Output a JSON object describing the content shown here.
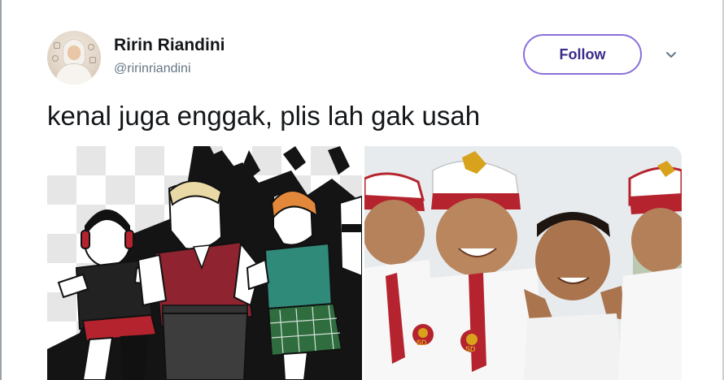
{
  "tweet": {
    "author_name": "Ririn Riandini",
    "author_handle": "@ririnriandini",
    "follow_label": "Follow",
    "text": "kenal juga enggak, plis lah gak usah"
  },
  "media": {
    "badge_left": "SD",
    "badge_right": "SD"
  },
  "colors": {
    "follow_border": "#8b6fd9",
    "follow_text": "#3b2a8a",
    "handle": "#657786",
    "text": "#14171a",
    "uniform_red": "#b5242e"
  },
  "icons": {
    "more": "chevron-down-icon"
  }
}
